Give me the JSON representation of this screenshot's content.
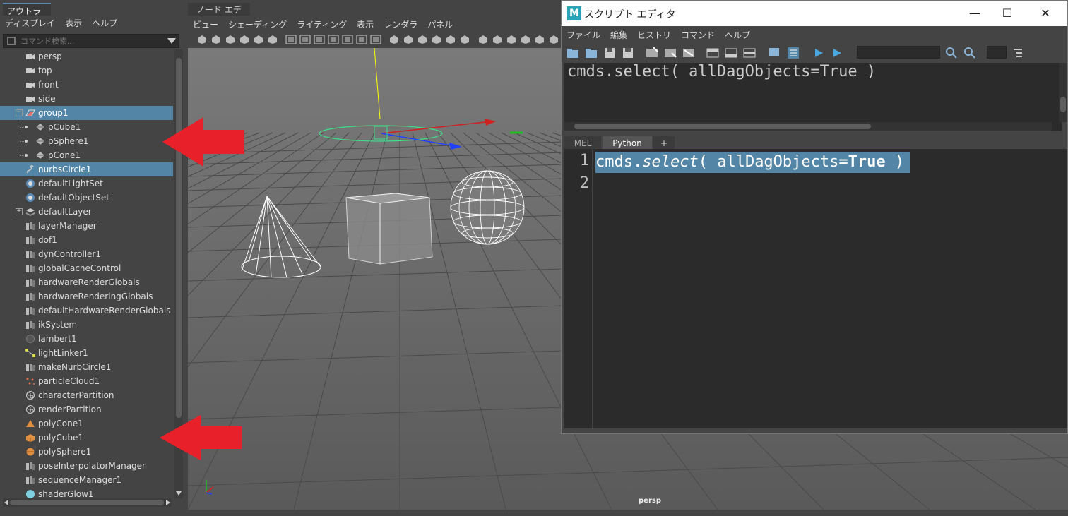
{
  "outliner": {
    "tab_label": "アウトライナ",
    "menu": [
      "ディスプレイ",
      "表示",
      "ヘルプ"
    ],
    "search_placeholder": "コマンド検索...",
    "items": [
      {
        "label": "persp",
        "icon": "camera-icon",
        "indent": 0,
        "selected": false
      },
      {
        "label": "top",
        "icon": "camera-icon",
        "indent": 0,
        "selected": false
      },
      {
        "label": "front",
        "icon": "camera-icon",
        "indent": 0,
        "selected": false
      },
      {
        "label": "side",
        "icon": "camera-icon",
        "indent": 0,
        "selected": false
      },
      {
        "label": "group1",
        "icon": "group-icon",
        "indent": 0,
        "selected": true
      },
      {
        "label": "pCube1",
        "icon": "mesh-icon",
        "indent": 1,
        "selected": false
      },
      {
        "label": "pSphere1",
        "icon": "mesh-icon",
        "indent": 1,
        "selected": false
      },
      {
        "label": "pCone1",
        "icon": "mesh-icon",
        "indent": 1,
        "selected": false
      },
      {
        "label": "nurbsCircle1",
        "icon": "curve-icon",
        "indent": 0,
        "selected": true
      },
      {
        "label": "defaultLightSet",
        "icon": "set-icon",
        "indent": 0,
        "selected": false
      },
      {
        "label": "defaultObjectSet",
        "icon": "set-icon",
        "indent": 0,
        "selected": false
      },
      {
        "label": "defaultLayer",
        "icon": "layer-icon",
        "indent": 0,
        "selected": false
      },
      {
        "label": "layerManager",
        "icon": "node-icon",
        "indent": 0,
        "selected": false
      },
      {
        "label": "dof1",
        "icon": "node-icon",
        "indent": 0,
        "selected": false
      },
      {
        "label": "dynController1",
        "icon": "node-icon",
        "indent": 0,
        "selected": false
      },
      {
        "label": "globalCacheControl",
        "icon": "node-icon",
        "indent": 0,
        "selected": false
      },
      {
        "label": "hardwareRenderGlobals",
        "icon": "node-icon",
        "indent": 0,
        "selected": false
      },
      {
        "label": "hardwareRenderingGlobals",
        "icon": "node-icon",
        "indent": 0,
        "selected": false
      },
      {
        "label": "defaultHardwareRenderGlobals",
        "icon": "node-icon",
        "indent": 0,
        "selected": false
      },
      {
        "label": "ikSystem",
        "icon": "node-icon",
        "indent": 0,
        "selected": false
      },
      {
        "label": "lambert1",
        "icon": "material-icon",
        "indent": 0,
        "selected": false
      },
      {
        "label": "lightLinker1",
        "icon": "light-linker-icon",
        "indent": 0,
        "selected": false
      },
      {
        "label": "makeNurbCircle1",
        "icon": "node-icon",
        "indent": 0,
        "selected": false
      },
      {
        "label": "particleCloud1",
        "icon": "particle-icon",
        "indent": 0,
        "selected": false
      },
      {
        "label": "characterPartition",
        "icon": "partition-icon",
        "indent": 0,
        "selected": false
      },
      {
        "label": "renderPartition",
        "icon": "partition-icon",
        "indent": 0,
        "selected": false
      },
      {
        "label": "polyCone1",
        "icon": "poly-cone-icon",
        "indent": 0,
        "selected": false
      },
      {
        "label": "polyCube1",
        "icon": "poly-cube-icon",
        "indent": 0,
        "selected": false
      },
      {
        "label": "polySphere1",
        "icon": "poly-sphere-icon",
        "indent": 0,
        "selected": false
      },
      {
        "label": "poseInterpolatorManager",
        "icon": "node-icon",
        "indent": 0,
        "selected": false
      },
      {
        "label": "sequenceManager1",
        "icon": "node-icon",
        "indent": 0,
        "selected": false
      },
      {
        "label": "shaderGlow1",
        "icon": "shader-glow-icon",
        "indent": 0,
        "selected": false
      }
    ]
  },
  "viewport": {
    "tab_label": "ノード エディタ",
    "menu": [
      "ビュー",
      "シェーディング",
      "ライティング",
      "表示",
      "レンダラ",
      "パネル"
    ],
    "camera_label": "persp"
  },
  "script_editor": {
    "title": "スクリプト エディタ",
    "logo": "M",
    "window_buttons": {
      "minimize": "—",
      "maximize": "☐",
      "close": "✕"
    },
    "menu": [
      "ファイル",
      "編集",
      "ヒストリ",
      "コマンド",
      "ヘルプ"
    ],
    "history_text": "cmds.select( allDagObjects=True )",
    "tabs": [
      "MEL",
      "Python",
      "+"
    ],
    "active_tab": "Python",
    "line_numbers": [
      "1",
      "2"
    ],
    "code": {
      "module": "cmds.",
      "func": "select",
      "open": "( allDagObjects=",
      "keyword": "True",
      "close": " )"
    }
  },
  "colors": {
    "selection": "#5285a6",
    "annotation_arrow": "#e8202a",
    "panel_bg": "#444444",
    "viewport_bg": "#6a6a6a"
  }
}
